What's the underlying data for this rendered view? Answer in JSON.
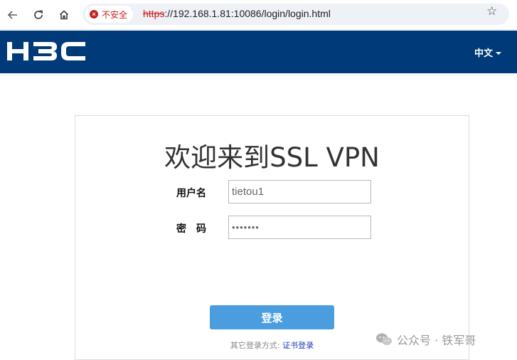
{
  "browser": {
    "security_label": "不安全",
    "url_scheme": "https",
    "url_rest": "://192.168.1.81:10086/login/login.html"
  },
  "header": {
    "logo_text": "H3C",
    "language": "中文",
    "bg_color": "#003a78"
  },
  "login": {
    "title": "欢迎来到SSL VPN",
    "username_label": "用户名",
    "username_value": "tietou1",
    "password_label": "密　码",
    "password_value": "1234567",
    "submit_label": "登录",
    "alt_prefix": "其它登录方式:",
    "alt_link": "证书登录",
    "button_color": "#4a9ee0"
  },
  "watermark": {
    "text": "公众号 · 铁军哥"
  }
}
